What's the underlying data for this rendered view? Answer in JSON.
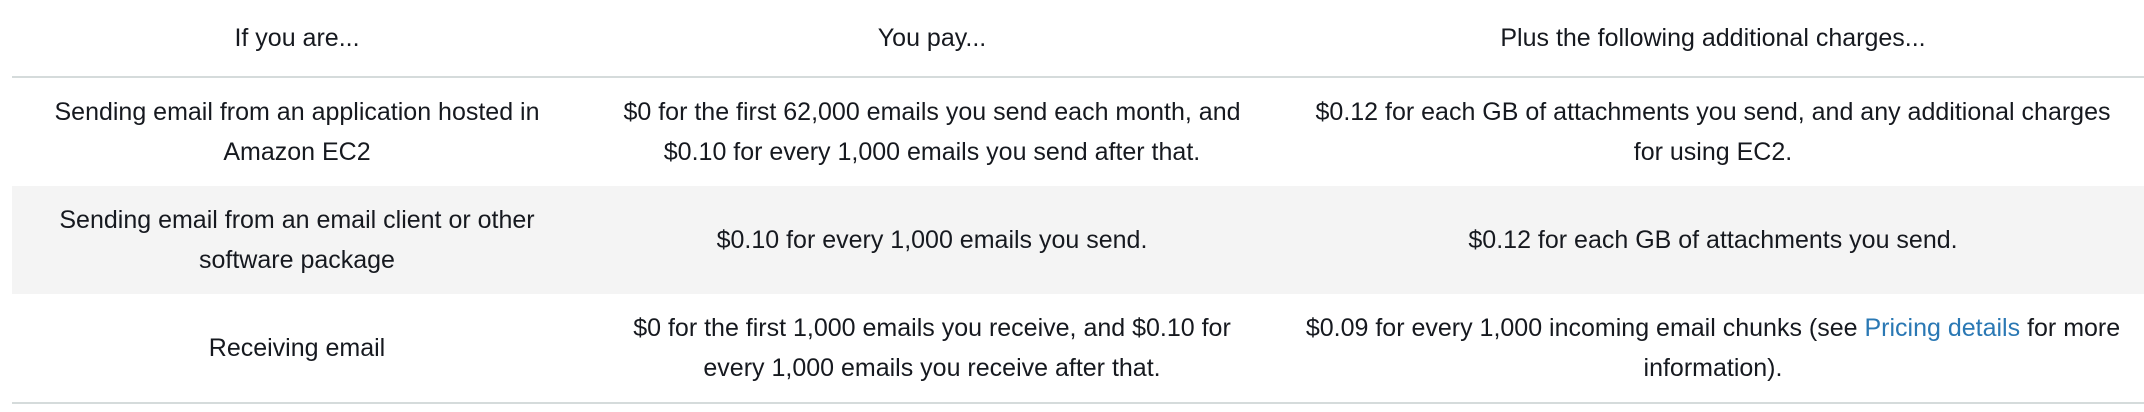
{
  "headers": {
    "col1": "If you are...",
    "col2": "You pay...",
    "col3": "Plus the following additional charges..."
  },
  "rows": [
    {
      "case": "Sending email from an application hosted in Amazon EC2",
      "pay": "$0 for the first 62,000 emails you send each month, and $0.10 for every 1,000 emails you send after that.",
      "additional": "$0.12 for each GB of attachments you send, and any additional charges for using EC2."
    },
    {
      "case": "Sending email from an email client or other software package",
      "pay": "$0.10 for every 1,000 emails you send.",
      "additional": "$0.12 for each GB of attachments you send."
    },
    {
      "case": "Receiving email",
      "pay": "$0 for the first 1,000 emails you receive, and $0.10 for every 1,000 emails you receive after that.",
      "additional_prefix": "$0.09 for every 1,000 incoming email chunks (see ",
      "additional_link": "Pricing details",
      "additional_suffix": " for more information)."
    }
  ],
  "colors": {
    "text": "#16191f",
    "link": "#2a78b4",
    "row_shade": "#f4f4f4",
    "rule": "#d5dbdb"
  }
}
